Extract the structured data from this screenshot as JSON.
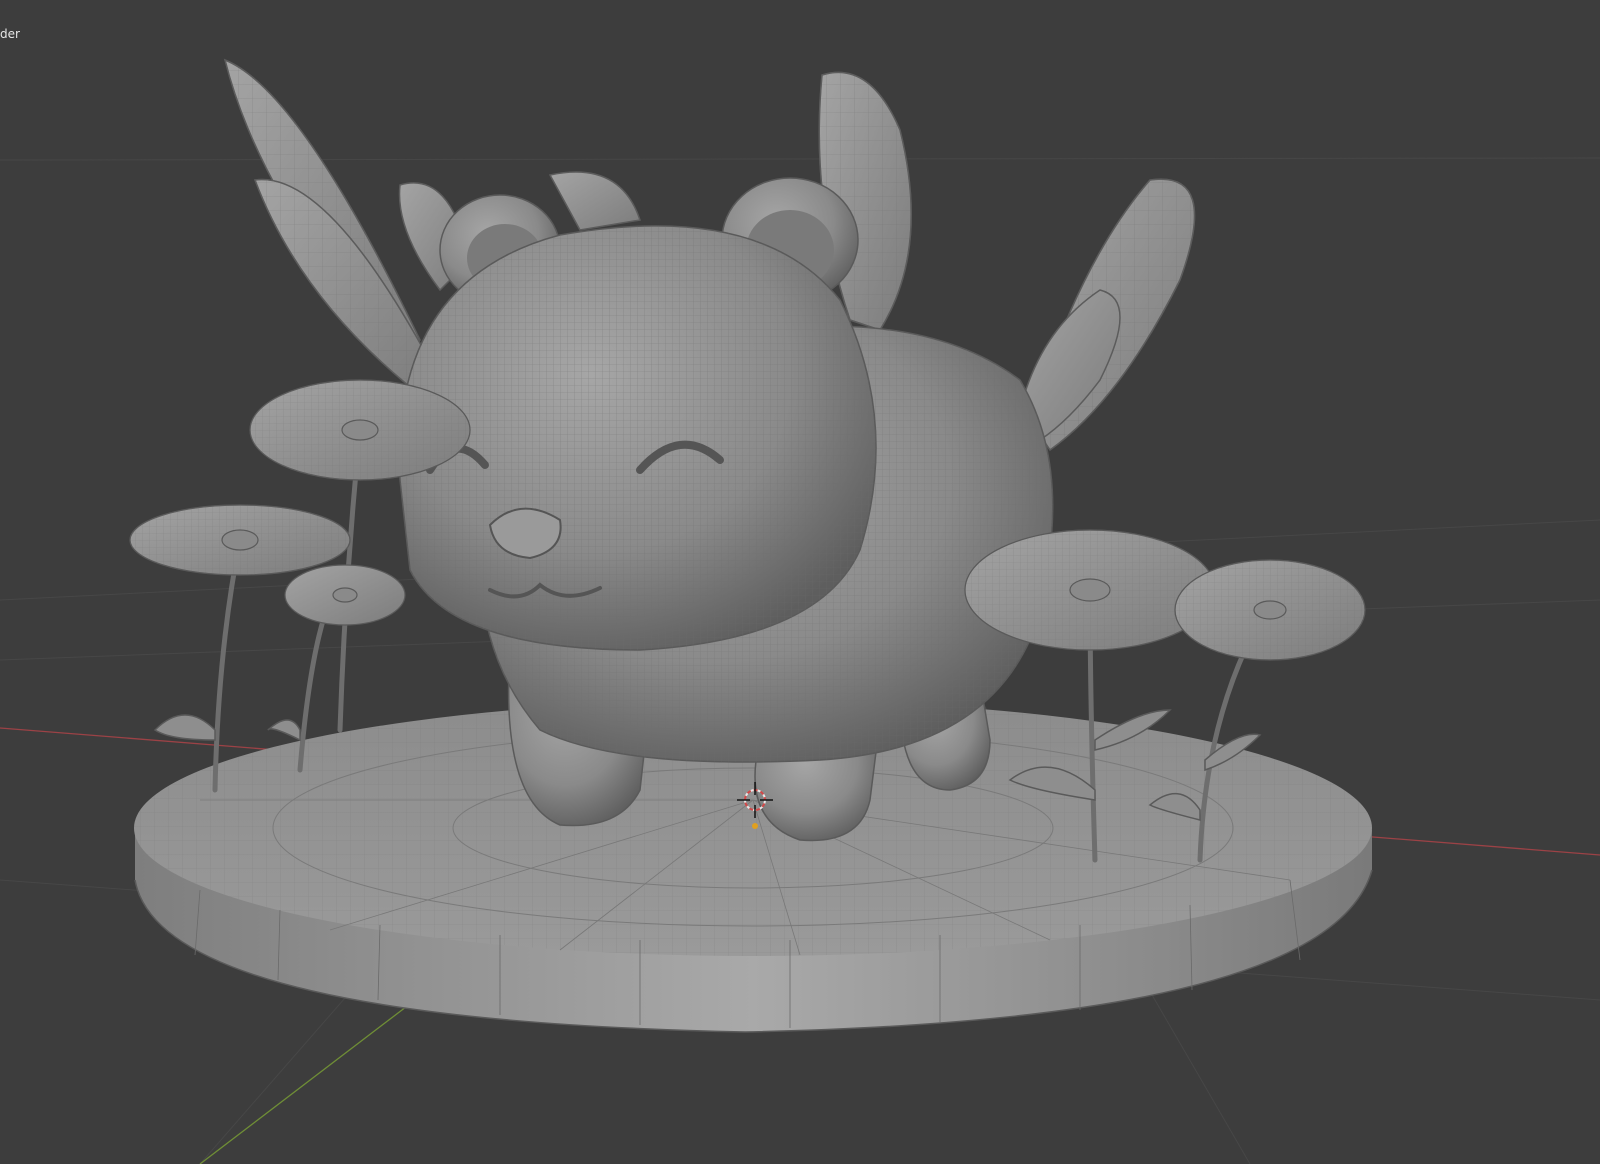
{
  "viewport": {
    "label": "der",
    "background": "#3d3d3d"
  },
  "scene": {
    "model_color": "#8d8d8d",
    "model_highlight": "#b5b5b5",
    "model_shadow": "#5a5a5a",
    "wire_color": "#4a4a4a",
    "x_axis_color": "#b5444a",
    "y_axis_color": "#7a9a3c",
    "objects": [
      "bear-body",
      "wings",
      "flowers",
      "base-disc",
      "3d-cursor"
    ]
  }
}
